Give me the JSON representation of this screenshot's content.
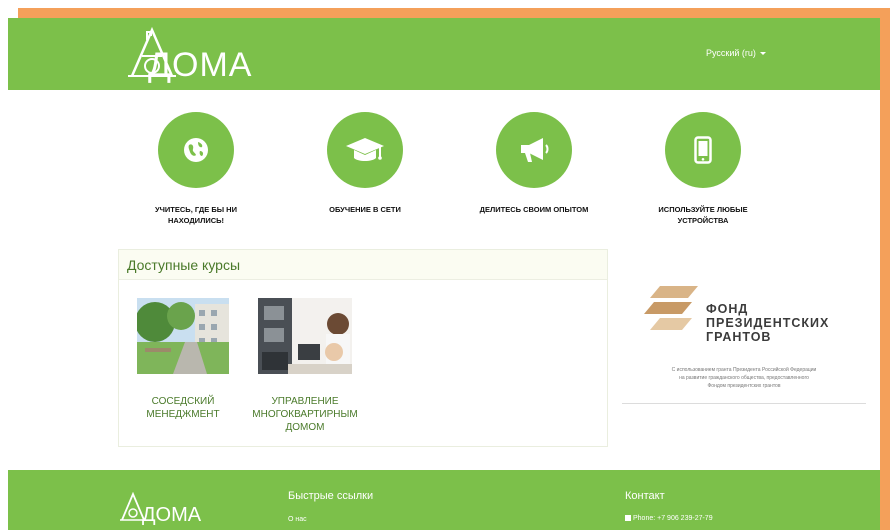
{
  "header": {
    "logo_text": "ДОМА",
    "language": "Русский (ru)"
  },
  "features": [
    {
      "icon": "globe-icon",
      "label_line1": "УЧИТЕСЬ, ГДЕ БЫ НИ",
      "label_line2": "НАХОДИЛИСЬ!"
    },
    {
      "icon": "graduation-cap-icon",
      "label_line1": "ОБУЧЕНИЕ В СЕТИ",
      "label_line2": ""
    },
    {
      "icon": "megaphone-icon",
      "label_line1": "ДЕЛИТЕСЬ СВОИМ ОПЫТОМ",
      "label_line2": ""
    },
    {
      "icon": "mobile-phone-icon",
      "label_line1": "ИСПОЛЬЗУЙТЕ ЛЮБЫЕ",
      "label_line2": "УСТРОЙСТВА"
    }
  ],
  "courses": {
    "heading": "Доступные курсы",
    "items": [
      {
        "line1": "СОСЕДСКИЙ",
        "line2": "МЕНЕДЖМЕНТ",
        "line3": ""
      },
      {
        "line1": "УПРАВЛЕНИЕ",
        "line2": "МНОГОКВАРТИРНЫМ",
        "line3": "ДОМОМ"
      }
    ]
  },
  "grant": {
    "title_line1": "ФОНД",
    "title_line2": "ПРЕЗИДЕНТСКИХ",
    "title_line3": "ГРАНТОВ",
    "note_line1": "С использованием гранта Президента Российской Федерации",
    "note_line2": "на развитие гражданского общества, предоставленного",
    "note_line3": "Фондом президентских грантов"
  },
  "footer": {
    "logo_text": "ДОМА",
    "quick_links_heading": "Быстрые ссылки",
    "about_link": "О нас",
    "contact_heading": "Контакт",
    "phone": "Phone: +7 906 239-27-79"
  },
  "colors": {
    "brand_green": "#7cc04a",
    "accent_orange": "#f4a05a",
    "course_text": "#4a7a2a"
  }
}
